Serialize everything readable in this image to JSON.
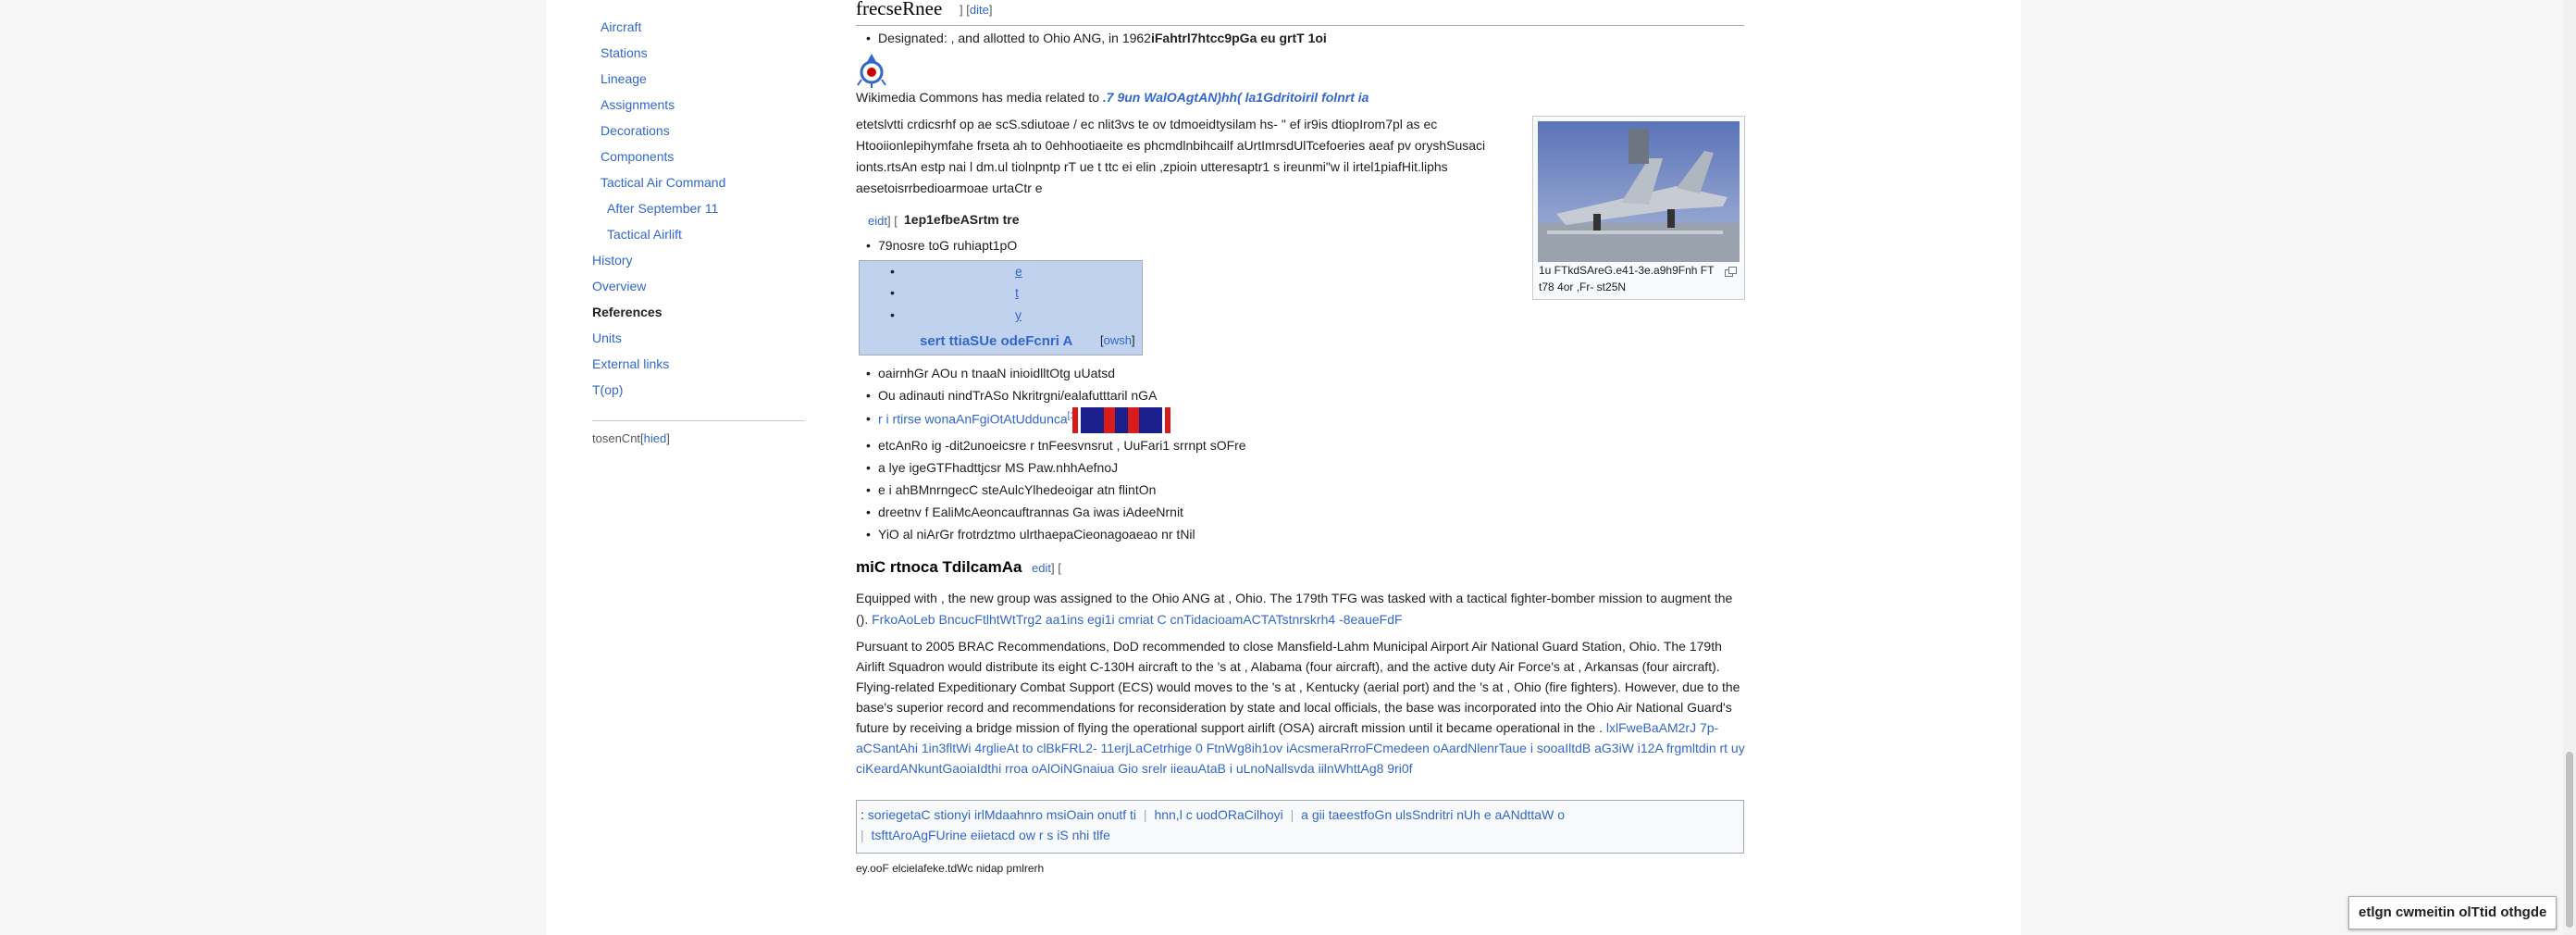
{
  "toc": {
    "items": [
      {
        "label": "Aircraft",
        "level": 2
      },
      {
        "label": "Stations",
        "level": 2
      },
      {
        "label": "Lineage",
        "level": 2
      },
      {
        "label": "Assignments",
        "level": 2
      },
      {
        "label": "Decorations",
        "level": 2
      },
      {
        "label": "Components",
        "level": 2
      },
      {
        "label": "Tactical Air Command",
        "level": 2
      },
      {
        "label": "After September 11",
        "level": 3
      },
      {
        "label": "Tactical Airlift",
        "level": 3
      },
      {
        "label": "History",
        "level": 1
      },
      {
        "label": "Overview",
        "level": 1
      },
      {
        "label": "References",
        "level": 1
      },
      {
        "label": "Units",
        "level": 1
      },
      {
        "label": "External links",
        "level": 1
      },
      {
        "label": "T(op)",
        "level": 1
      }
    ],
    "hide_label": "tosenCnt[",
    "hide_link": "hied",
    "hide_close": "]"
  },
  "section1": {
    "heading": "frecseRnee",
    "edit_open": "] [",
    "edit_label": "dite",
    "edit_close": "]",
    "designated_prefix": "Designated: , and allotted to Ohio ANG, in 1962",
    "designated_bold": "iFahtrl7htcc9pGa eu grtT 1oi"
  },
  "commons": {
    "prefix": "Wikimedia Commons has media related to",
    "link": ".7 9un WalOAgtAN)hh( la1Gdritoiril folnrt ia"
  },
  "intro": {
    "line1": "etetslvtti crdicsrhf op ae scS.sdiutoae / ec nlit3vs te ov tdmoeidtysilam hs- \" ef ir9is dtiopIrom7pl as ec",
    "line2": "Htooiionlepihymfahe frseta ah to 0ehhootiaeite es phcmdlnbihcailf aUrtImrsdUlTcefoeries aeaf pv oryshSusaci",
    "line3": "ionts.rtsAn estp nai l dm.ul tiolnpntp rT ue t ttc ei elin ,zpioin utteresaptr1 s ireunmi\"w il irtel1piafHit.liphs",
    "line4": "aesetoisrrbedioarmoae urtaCtr e"
  },
  "subsection": {
    "edit_label": "eidt",
    "edit_bracket": "] [",
    "heading": "1ep1efbeASrtm tre",
    "first_item": "79nosre toG ruhiapt1pO"
  },
  "navbox": {
    "items": [
      "e",
      "t",
      "y"
    ],
    "title": "sert ttiaSUe odeFcnri A",
    "show_open": "[",
    "show_label": "owsh",
    "show_close": "]"
  },
  "list_items": [
    {
      "text": "oairnhGr AOu n tnaaN inioidlltOtg uUatsd",
      "link": false
    },
    {
      "text": "Ou adinauti nindTrASo Nkritrgni/ealafutttaril nGA",
      "link": false
    },
    {
      "text": "r i rtirse wonaAnFgiOtAtUddunca",
      "link": true,
      "sup": "[1]"
    },
    {
      "text": "etcAnRo ig -dit2unoeicsre r tnFeesvnsrut , UuFari1 srrnpt sOFre",
      "link": false
    },
    {
      "text": "a lye igeGTFhadttjcsr MS Paw.nhhAefnoJ",
      "link": false
    },
    {
      "text": "e i ahBMnrngecC steAulcYlhedeoigar atn flintOn",
      "link": false
    },
    {
      "text": "dreetnv f EaliMcAeoncauftrannas Ga iwas iAdeeNrnit",
      "link": false
    },
    {
      "text": "YiO al niArGr frotrdztmo ulrthaepaCieonagoaeao nr tNil",
      "link": false
    }
  ],
  "section2": {
    "heading": "miC rtnoca TdilcamAa",
    "edit_label": "edit",
    "edit_close": "] [",
    "para1_line1": "Equipped with , the new group was assigned to the Ohio ANG at , Ohio. The 179th TFG was tasked with a tactical fighter-bomber mission to augment the",
    "para1_line2_prefix": "().",
    "para1_line2_link": "FrkoAoLeb BncucFtlhtWtTrg2 aa1ins egi1i cmriat C cnTidacioamACTATstnrskrh4 -8eaueFdF",
    "para2_line1": "Pursuant to 2005 BRAC Recommendations, DoD recommended to close Mansfield-Lahm Municipal Airport Air National Guard Station, Ohio. The 179th",
    "para2_line2": "Airlift Squadron would distribute its eight C-130H aircraft to the 's at , Alabama (four aircraft), and the active duty Air Force's at , Arkansas (four aircraft).",
    "para2_line3": "Flying-related Expeditionary Combat Support (ECS) would moves to the 's at , Kentucky (aerial port) and the 's at , Ohio (fire fighters). However, due to the",
    "para2_line4": "base's superior record and recommendations for reconsideration by state and local officials, the base was incorporated into the Ohio Air National Guard's",
    "para2_line5_prefix": "future by receiving a bridge mission of flying the operational support airlift (OSA) aircraft mission until it became operational in the .",
    "para2_line5_link": "lxlFweBaAM2rJ 7p-",
    "para2_line6": "aCSantAhi 1in3fltWi 4rglieAt to clBkFRL2- 11erjLaCetrhige 0 FtnWg8ih1ov iAcsmeraRrroFCmedeen oAardNlenrTaue i sooaIltdB aG3iW i12A frgmltdin rt uy",
    "para2_line7": "ciKeardANkuntGaoiaIdthi rroa oAlOiNGnaiua Gio srelr iieauAtaB i uLnoNallsvda iilnWhttAg8 9ri0f"
  },
  "categories": {
    "lead": ":",
    "items": [
      "soriegetaC stionyi irlMdaahnro msiOain onutf ti",
      "hnn,l c uodORaCilhoyi",
      "a gii taeestfoGn ulsSndritri nUh e aANdttaW o",
      "tsfttAroAgFUrine eiietacd ow r s iS nhi tlfe"
    ]
  },
  "footer": {
    "last_edited": "ey.ooF elcielafeke.tdWc nidap pmlrerh"
  },
  "thumbnail": {
    "caption_line1": "1u FTkdSAreG.e41-3e.a9h9Fnh FT",
    "caption_line2": "t78 4or ,Fr- st25N"
  },
  "float_button": "etlgn cwmeitin olTtid othgde",
  "colors": {
    "link": "#3366cc",
    "navbox_bg": "#c1d2ee",
    "ribbon_blue": "#1a1f8c",
    "ribbon_red": "#d81b1b"
  }
}
